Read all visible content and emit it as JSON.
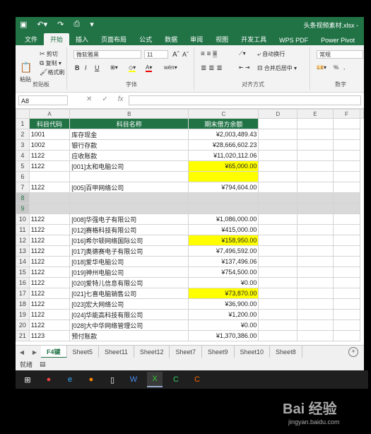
{
  "window": {
    "title": "头条视频素材.xlsx -"
  },
  "ribbon_tabs": [
    "文件",
    "开始",
    "插入",
    "页面布局",
    "公式",
    "数据",
    "审阅",
    "视图",
    "开发工具",
    "WPS PDF",
    "Power Pivot"
  ],
  "clipboard": {
    "paste": "粘贴",
    "cut": "剪切",
    "copy": "复制",
    "format_painter": "格式刷",
    "label": "剪贴板"
  },
  "font": {
    "name": "微软雅黑",
    "size": "11",
    "bold": "B",
    "italic": "I",
    "underline": "U",
    "grow": "A",
    "shrink": "A",
    "color_a": "A",
    "wen": "wén",
    "label": "字体"
  },
  "alignment": {
    "wrap": "自动换行",
    "merge": "合并后居中",
    "label": "对齐方式"
  },
  "number": {
    "format": "常规",
    "percent": "%",
    "comma": ",",
    "label": "数字"
  },
  "formula_bar": {
    "cell_ref": "A8",
    "fx": "fx",
    "value": ""
  },
  "columns": [
    "A",
    "B",
    "C",
    "D",
    "E",
    "F"
  ],
  "rows": [
    {
      "n": "1",
      "a": "科目代码",
      "b": "科目名称",
      "c": "期末借方余额",
      "type": "header"
    },
    {
      "n": "2",
      "a": "1001",
      "b": "库存现金",
      "c": "¥2,003,489.43"
    },
    {
      "n": "3",
      "a": "1002",
      "b": "银行存款",
      "c": "¥28,666,602.23"
    },
    {
      "n": "4",
      "a": "1122",
      "b": "应收账款",
      "c": "¥11,020,112.06"
    },
    {
      "n": "5",
      "a": "1122",
      "b": "[001]太和电脑公司",
      "c": "¥65,000.00",
      "hl": true
    },
    {
      "n": "6",
      "a": "",
      "b": "",
      "c": "",
      "hl": true
    },
    {
      "n": "7",
      "a": "1122",
      "b": "[005]百甲网络公司",
      "c": "¥794,604.00"
    },
    {
      "n": "8",
      "a": "",
      "b": "",
      "c": "",
      "sel": true
    },
    {
      "n": "9",
      "a": "",
      "b": "",
      "c": "",
      "sel": true
    },
    {
      "n": "10",
      "a": "1122",
      "b": "[008]华强电子有限公司",
      "c": "¥1,086,000.00"
    },
    {
      "n": "11",
      "a": "1122",
      "b": "[012]赛格科技有限公司",
      "c": "¥415,000.00"
    },
    {
      "n": "12",
      "a": "1122",
      "b": "[016]希尔顿网络国际公司",
      "c": "¥158,950.00",
      "hl": true
    },
    {
      "n": "13",
      "a": "1122",
      "b": "[017]奥德赛电子有限公司",
      "c": "¥7,496,592.00"
    },
    {
      "n": "14",
      "a": "1122",
      "b": "[018]爱华电脑公司",
      "c": "¥137,496.06"
    },
    {
      "n": "15",
      "a": "1122",
      "b": "[019]神州电脑公司",
      "c": "¥754,500.00"
    },
    {
      "n": "16",
      "a": "1122",
      "b": "[020]爱特儿信息有限公司",
      "c": "¥0.00"
    },
    {
      "n": "17",
      "a": "1122",
      "b": "[021]七喜电脑销售公司",
      "c": "¥73,870.00",
      "hl": true
    },
    {
      "n": "18",
      "a": "1122",
      "b": "[023]宏大网络公司",
      "c": "¥36,900.00"
    },
    {
      "n": "19",
      "a": "1122",
      "b": "[024]华能高科技有限公司",
      "c": "¥1,200.00"
    },
    {
      "n": "20",
      "a": "1122",
      "b": "[028]大中华网络管理公司",
      "c": "¥0.00"
    },
    {
      "n": "21",
      "a": "1123",
      "b": "预付账款",
      "c": "¥1,370,386.00"
    }
  ],
  "sheets": [
    "F4键",
    "Sheet5",
    "Sheet11",
    "Sheet12",
    "Sheet7",
    "Sheet9",
    "Sheet10",
    "Sheet8"
  ],
  "active_sheet": "F4键",
  "status": {
    "ready": "就绪"
  },
  "watermark": {
    "brand": "Bai 经验",
    "url": "jingyan.baidu.com"
  },
  "colors": {
    "excel_green": "#217346",
    "highlight": "#ffff00",
    "selection": "#d9d9d9"
  }
}
